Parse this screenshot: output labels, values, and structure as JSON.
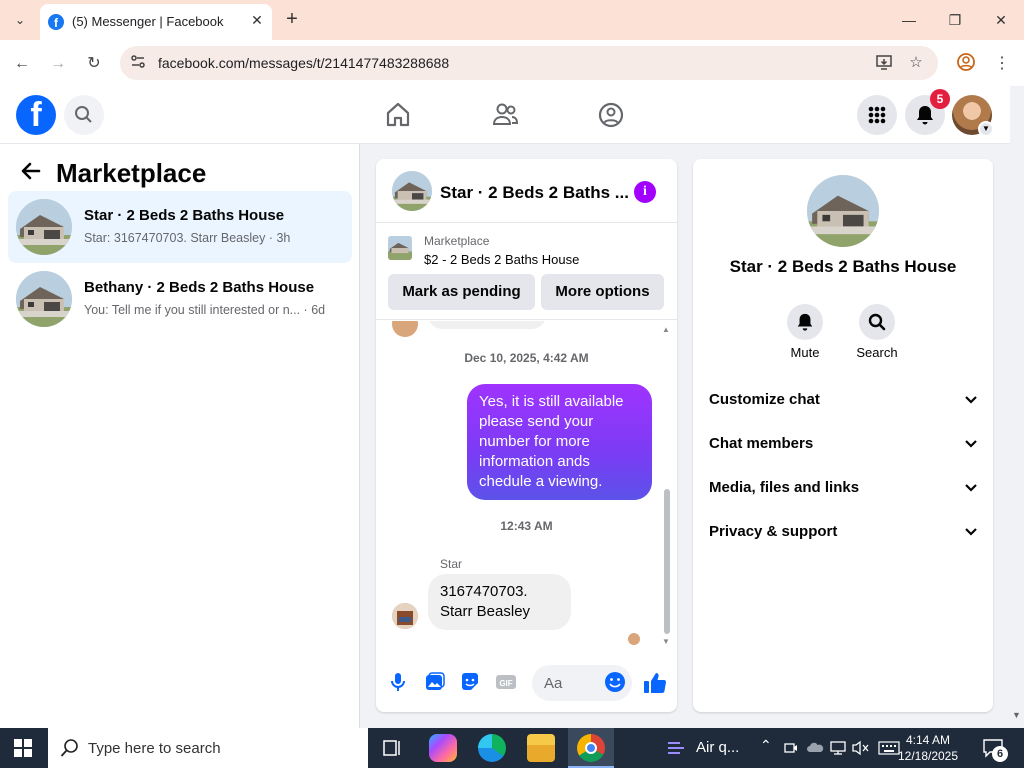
{
  "browser": {
    "tab_title": "(5) Messenger | Facebook",
    "url": "facebook.com/messages/t/2141477483288688",
    "tab_close": "✕",
    "new_tab": "+",
    "tab_menu": "⌄"
  },
  "header": {
    "notification_count": "5",
    "logo_letter": "f"
  },
  "sidebar": {
    "title": "Marketplace",
    "conversations": [
      {
        "title": "Star · 2 Beds 2 Baths House",
        "subtitle": "Star: 3167470703. Starr Beasley · 3h",
        "active": true
      },
      {
        "title": "Bethany · 2 Beds 2 Baths House",
        "subtitle": "You: Tell me if you still interested or n... · 6d",
        "active": false
      }
    ]
  },
  "chat": {
    "title": "Star · 2 Beds 2 Baths ...",
    "info_letter": "i",
    "listing_label": "Marketplace",
    "listing_price": "$2 - 2 Beds 2 Baths House",
    "mark_pending": "Mark as pending",
    "more_options": "More options",
    "timestamp1": "Dec 10, 2025, 4:42 AM",
    "outgoing_message": "Yes, it is still available please send your number for more information ands chedule a viewing.",
    "timestamp2": "12:43 AM",
    "sender_name": "Star",
    "incoming_message": "3167470703. Starr Beasley",
    "composer_placeholder": "Aa"
  },
  "info_panel": {
    "title": "Star · 2 Beds 2 Baths House",
    "mute_label": "Mute",
    "search_label": "Search",
    "sections": [
      "Customize chat",
      "Chat members",
      "Media, files and links",
      "Privacy & support"
    ]
  },
  "taskbar": {
    "search_placeholder": "Type here to search",
    "weather_label": "Air q...",
    "time": "4:14 AM",
    "date": "12/18/2025",
    "notification_count": "6"
  },
  "colors": {
    "fb_blue": "#0866ff",
    "messenger_purple": "#a200ff",
    "badge_red": "#e41e3f"
  }
}
